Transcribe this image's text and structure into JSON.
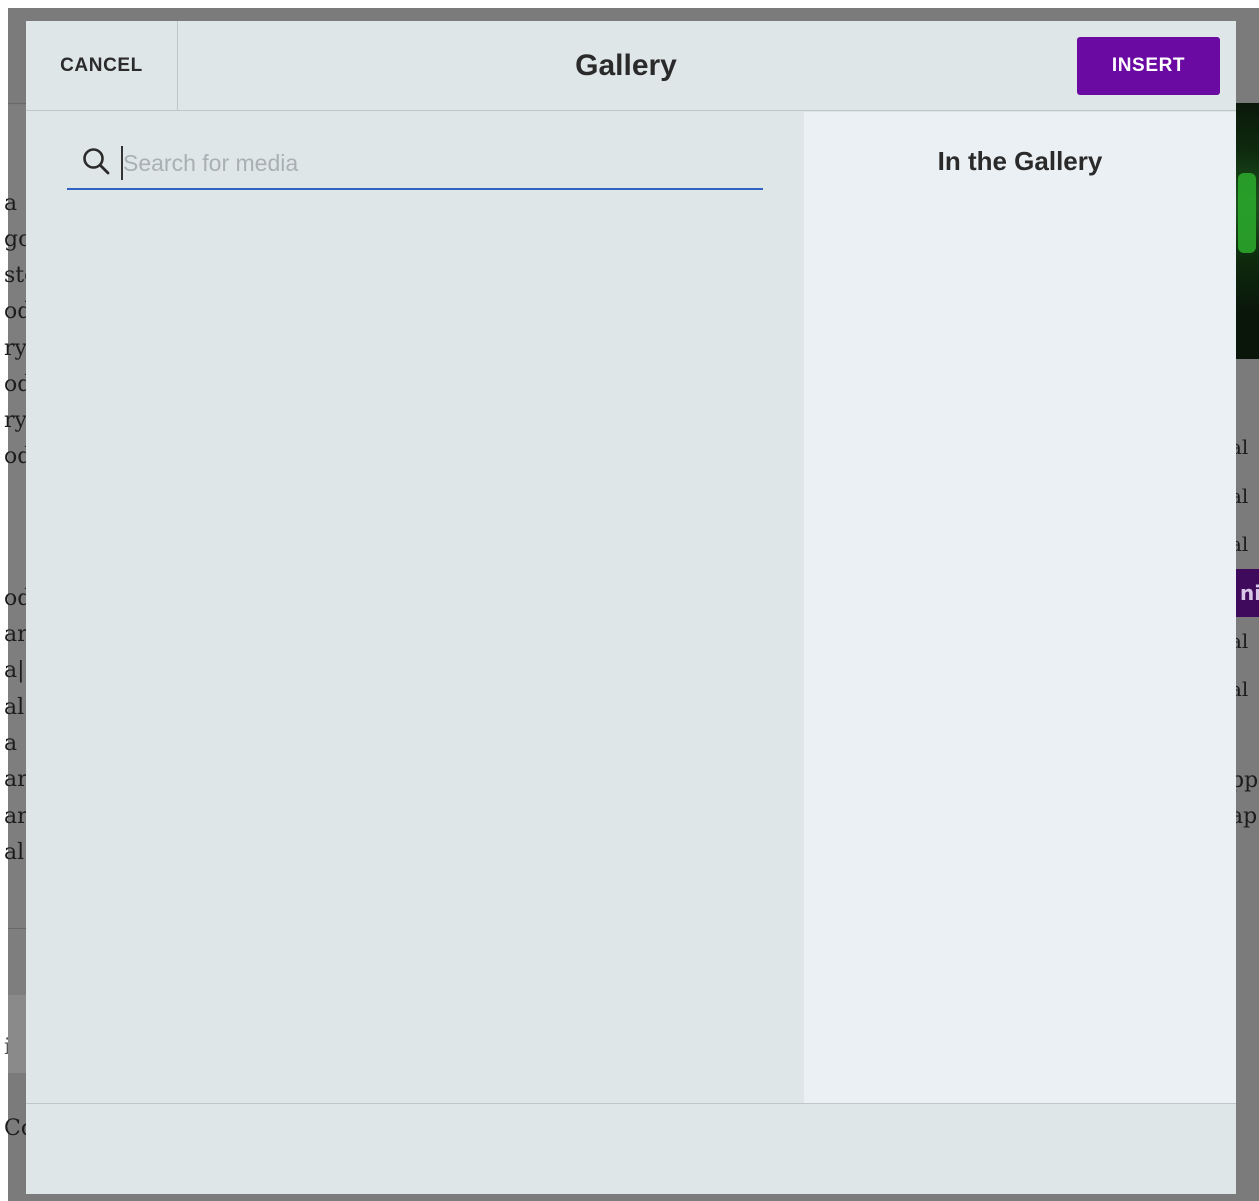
{
  "background": {
    "left_fragments": [
      "a",
      "go",
      "sto",
      "od",
      "ry",
      "od",
      "ry",
      "od",
      "od",
      "ar",
      "a|",
      "al",
      "a",
      "ar",
      "ar",
      "al",
      "ig",
      "Co"
    ],
    "right_fragments": [
      "al",
      "al",
      "al",
      "ni",
      "al",
      "al",
      "pp",
      "ap"
    ]
  },
  "dialog": {
    "cancel_label": "CANCEL",
    "title": "Gallery",
    "insert_label": "INSERT",
    "search": {
      "placeholder": "Search for media",
      "value": ""
    },
    "right_panel_title": "In the Gallery"
  },
  "colors": {
    "accent": "#6b0aa3",
    "focus_underline": "#2f62c4",
    "dialog_bg": "#dfe6e7",
    "right_panel_bg": "#eaf0f3"
  }
}
